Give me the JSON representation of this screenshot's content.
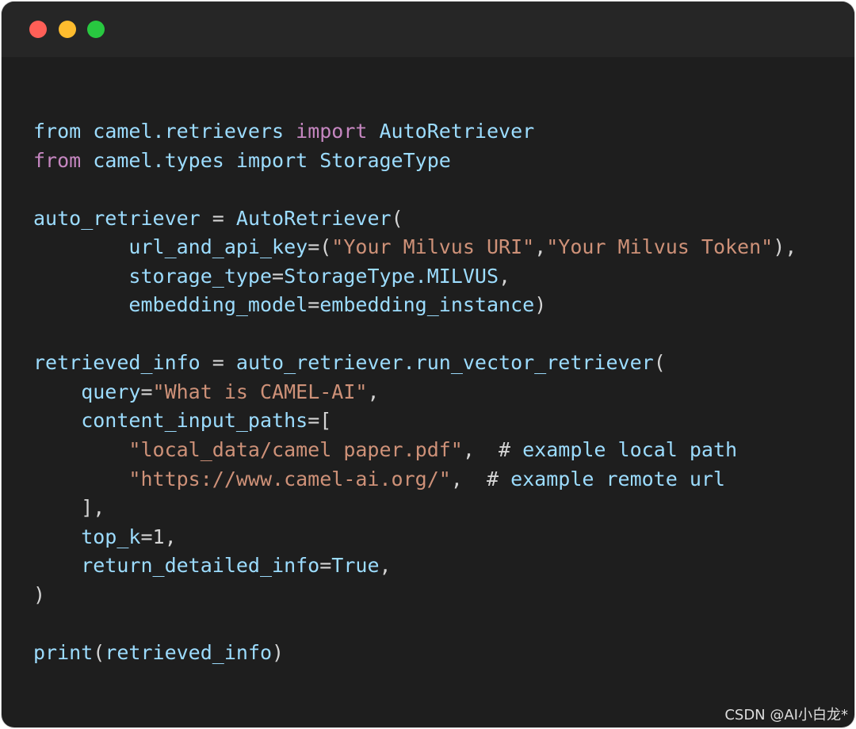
{
  "window": {
    "controls": {
      "close_color": "#ff5f57",
      "minimize_color": "#febc2e",
      "maximize_color": "#28c840"
    }
  },
  "colors": {
    "default": "#9cdcfe",
    "keyword": "#c586c0",
    "string": "#ce9178",
    "plain": "#d4d4d4"
  },
  "code": {
    "lines": [
      [
        {
          "t": "from ",
          "c": "default"
        },
        {
          "t": "camel.retrievers ",
          "c": "default"
        },
        {
          "t": "import ",
          "c": "keyword"
        },
        {
          "t": "AutoRetriever",
          "c": "default"
        }
      ],
      [
        {
          "t": "from ",
          "c": "keyword"
        },
        {
          "t": "camel.types ",
          "c": "default"
        },
        {
          "t": "import ",
          "c": "default"
        },
        {
          "t": "StorageType",
          "c": "default"
        }
      ],
      [],
      [
        {
          "t": "auto_retriever ",
          "c": "default"
        },
        {
          "t": "= ",
          "c": "plain"
        },
        {
          "t": "AutoRetriever",
          "c": "default"
        },
        {
          "t": "(",
          "c": "plain"
        }
      ],
      [
        {
          "t": "        url_and_api_key",
          "c": "default"
        },
        {
          "t": "=(",
          "c": "plain"
        },
        {
          "t": "\"Your Milvus URI\"",
          "c": "string"
        },
        {
          "t": ",",
          "c": "plain"
        },
        {
          "t": "\"Your Milvus Token\"",
          "c": "string"
        },
        {
          "t": "),",
          "c": "plain"
        }
      ],
      [
        {
          "t": "        storage_type",
          "c": "default"
        },
        {
          "t": "=",
          "c": "plain"
        },
        {
          "t": "StorageType.MILVUS",
          "c": "default"
        },
        {
          "t": ",",
          "c": "plain"
        }
      ],
      [
        {
          "t": "        embedding_model",
          "c": "default"
        },
        {
          "t": "=",
          "c": "plain"
        },
        {
          "t": "embedding_instance",
          "c": "default"
        },
        {
          "t": ")",
          "c": "plain"
        }
      ],
      [],
      [
        {
          "t": "retrieved_info ",
          "c": "default"
        },
        {
          "t": "= ",
          "c": "plain"
        },
        {
          "t": "auto_retriever.run_vector_retriever",
          "c": "default"
        },
        {
          "t": "(",
          "c": "plain"
        }
      ],
      [
        {
          "t": "    query",
          "c": "default"
        },
        {
          "t": "=",
          "c": "plain"
        },
        {
          "t": "\"What is CAMEL-AI\"",
          "c": "string"
        },
        {
          "t": ",",
          "c": "plain"
        }
      ],
      [
        {
          "t": "    content_input_paths",
          "c": "default"
        },
        {
          "t": "=[",
          "c": "plain"
        }
      ],
      [
        {
          "t": "        \"local_data/camel paper.pdf\"",
          "c": "string"
        },
        {
          "t": ",  # ",
          "c": "plain"
        },
        {
          "t": "example local path",
          "c": "default"
        }
      ],
      [
        {
          "t": "        \"https://www.camel-ai.org/\"",
          "c": "string"
        },
        {
          "t": ",  # ",
          "c": "plain"
        },
        {
          "t": "example remote url",
          "c": "default"
        }
      ],
      [
        {
          "t": "    ],",
          "c": "plain"
        }
      ],
      [
        {
          "t": "    top_k",
          "c": "default"
        },
        {
          "t": "=1,",
          "c": "plain"
        }
      ],
      [
        {
          "t": "    return_detailed_info",
          "c": "default"
        },
        {
          "t": "=",
          "c": "plain"
        },
        {
          "t": "True",
          "c": "default"
        },
        {
          "t": ",",
          "c": "plain"
        }
      ],
      [
        {
          "t": ")",
          "c": "plain"
        }
      ],
      [],
      [
        {
          "t": "print",
          "c": "default"
        },
        {
          "t": "(",
          "c": "plain"
        },
        {
          "t": "retrieved_info",
          "c": "default"
        },
        {
          "t": ")",
          "c": "plain"
        }
      ]
    ]
  },
  "watermark": "CSDN @AI小白龙*"
}
